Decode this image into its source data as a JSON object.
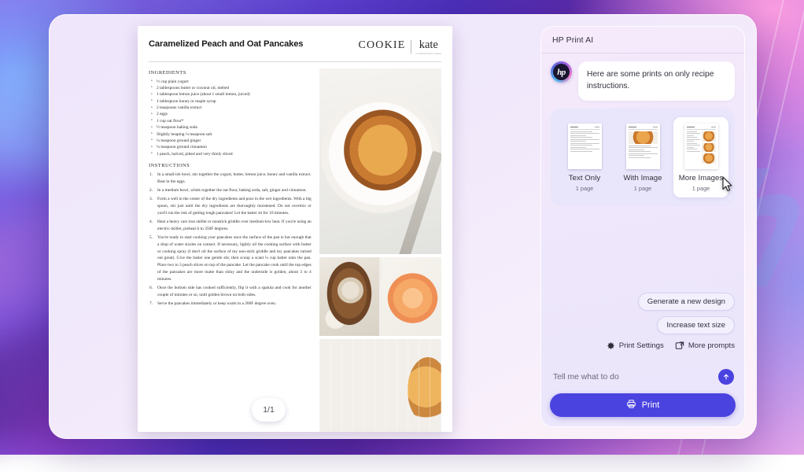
{
  "document": {
    "title": "Caramelized Peach and Oat Pancakes",
    "brand": {
      "primary": "COOKIE",
      "secondary": "kate",
      "tagline": "a cookbook about cookies"
    },
    "ingredients_heading": "INGREDIENTS",
    "ingredients": [
      "½ cup plain yogurt",
      "2 tablespoons butter or coconut oil, melted",
      "1 tablespoon lemon juice (about 1 small lemon, juiced)",
      "1 tablespoon honey or maple syrup",
      "2 teaspoons vanilla extract",
      "2 eggs",
      "1 cup oat flour*",
      "½ teaspoon baking soda",
      "Slightly heaping ¼ teaspoon salt",
      "¼ teaspoon ground ginger",
      "¼ teaspoon ground cinnamon",
      "1 peach, halved, pitted and very thinly sliced"
    ],
    "instructions_heading": "INSTRUCTIONS",
    "instructions": [
      "In a small-ish bowl, stir together the yogurt, butter, lemon juice, honey and vanilla extract. Beat in the eggs.",
      "In a medium bowl, whisk together the oat flour, baking soda, salt, ginger and cinnamon.",
      "Form a well in the center of the dry ingredients and pour in the wet ingredients. With a big spoon, stir just until the dry ingredients are thoroughly moistened. Do not overmix or you'll run the risk of getting tough pancakes! Let the batter sit for 10 minutes.",
      "Heat a heavy cast iron skillet or nonstick griddle over medium-low heat. If you're using an electric skillet, preheat it to 350F degrees.",
      "You're ready to start cooking your pancakes once the surface of the pan is hot enough that a drop of water sizzles on contact. If necessary, lightly oil the cooking surface with butter or cooking spray (I don't oil the surface of my non-stick griddle and my pancakes turned out great). Give the batter one gentle stir, then scoop a scant ¼ cup batter onto the pan. Place two to 3 peach slices on top of the pancake. Let the pancake cook until the top edges of the pancakes are more matte than shiny and the underside is golden, about 3 to 4 minutes.",
      "Once the bottom side has cooked sufficiently, flip it with a spatula and cook for another couple of minutes or so, until golden brown on both sides.",
      "Serve the pancakes immediately or keep warm in a 200F degree oven."
    ],
    "photo_captions": [
      "pancake-stack-on-plate-photo",
      "batter-bowl-photo",
      "whole-peach-photo",
      "caramelized-peach-pancake-closeup-photo"
    ],
    "page_indicator": "1/1"
  },
  "ai_panel": {
    "title": "HP Print AI",
    "avatar_text": "hp",
    "assistant_message": "Here are some prints on only recipe instructions.",
    "options": [
      {
        "label": "Text Only",
        "pages": "1 page",
        "selected": false
      },
      {
        "label": "With Image",
        "pages": "1 page",
        "selected": false
      },
      {
        "label": "More Images",
        "pages": "1 page",
        "selected": true
      }
    ],
    "suggestions": [
      "Generate a new design",
      "Increase text size"
    ],
    "tools": [
      {
        "label": "Print Settings",
        "icon": "gear-icon"
      },
      {
        "label": "More prompts",
        "icon": "shuffle-box-icon"
      }
    ],
    "prompt": {
      "value": "",
      "placeholder": "Tell me what to do"
    },
    "send_icon": "arrow-up-icon",
    "print_button": {
      "label": "Print",
      "icon": "printer-icon"
    }
  },
  "theme": {
    "accent": "#4a43e0",
    "panel_bg": "#efe7fb",
    "card_bg": "#e8e6fb"
  }
}
